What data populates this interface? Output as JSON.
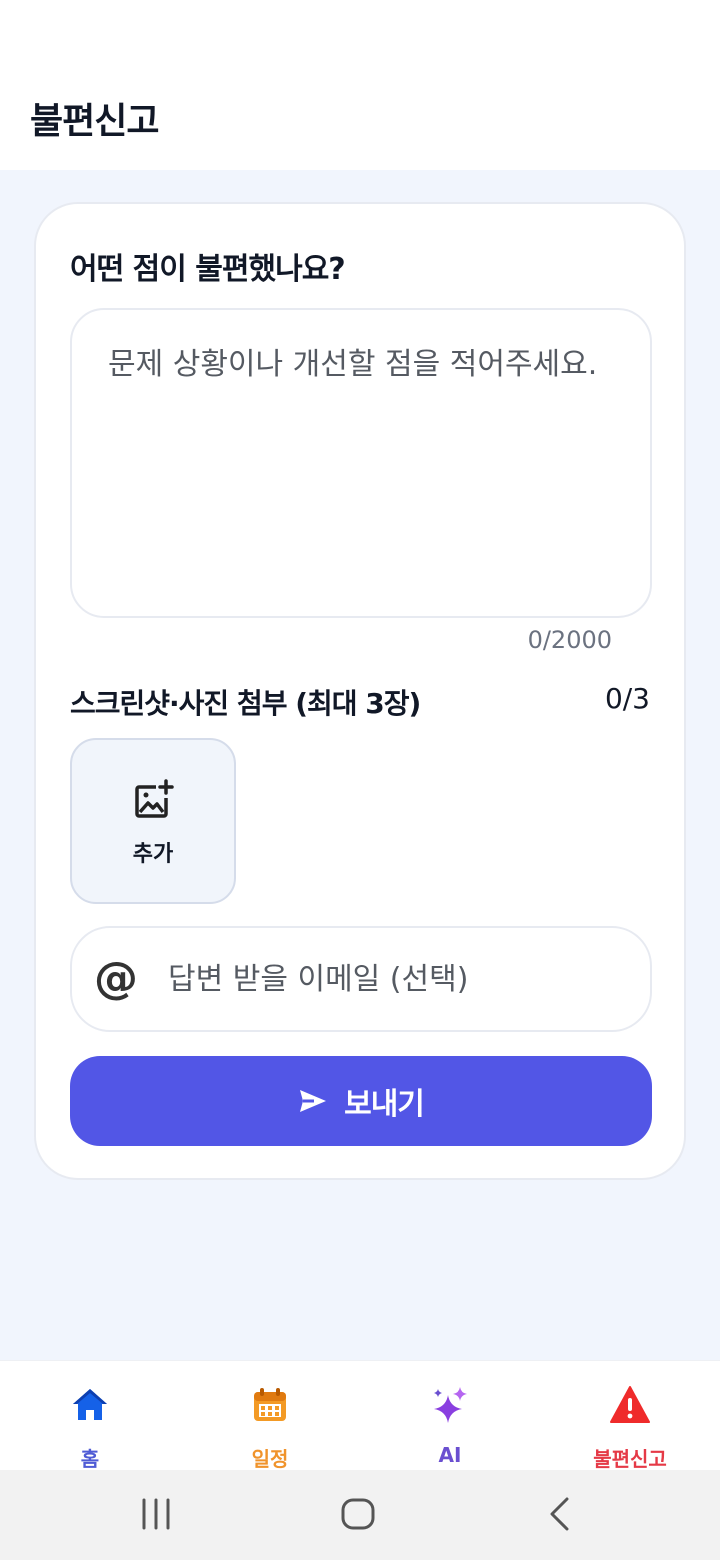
{
  "header": {
    "title": "불편신고"
  },
  "form": {
    "question": "어떤 점이 불편했나요?",
    "description_placeholder": "문제 상황이나 개선할 점을 적어주세요.",
    "description_value": "",
    "char_count": "0/2000",
    "attach_label": "스크린샷·사진 첨부 (최대 3장)",
    "attach_count": "0/3",
    "add_photo_label": "추가",
    "email_icon": "@",
    "email_placeholder": "답변 받을 이메일 (선택)",
    "email_value": "",
    "send_label": "보내기"
  },
  "nav": {
    "items": [
      {
        "label": "홈",
        "icon": "home-icon",
        "color": "#4f5bd5"
      },
      {
        "label": "일정",
        "icon": "calendar-icon",
        "color": "#f0932b"
      },
      {
        "label": "AI",
        "icon": "sparkles-icon",
        "color": "#6a4fd0"
      },
      {
        "label": "불편신고",
        "icon": "warning-icon",
        "color": "#e53946"
      }
    ]
  },
  "colors": {
    "accent": "#5256e6",
    "background": "#f1f5fd"
  }
}
